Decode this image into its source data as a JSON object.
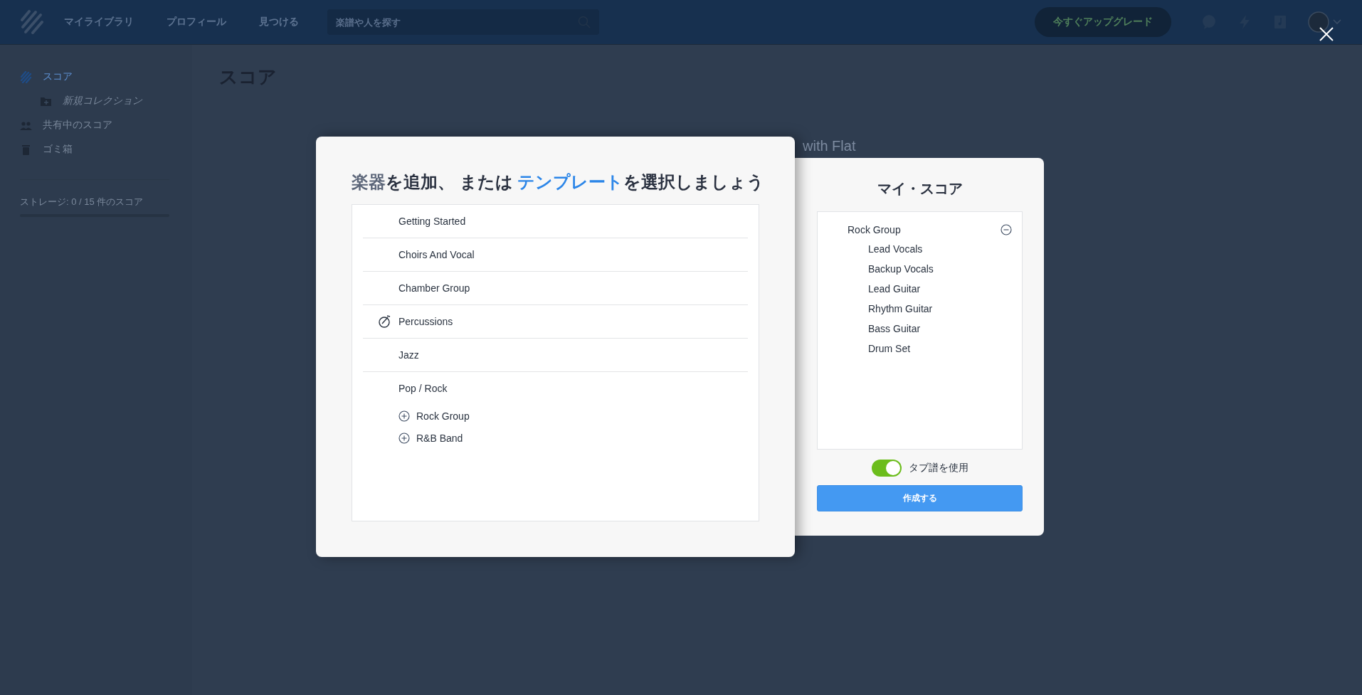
{
  "topbar": {
    "nav": [
      {
        "label": "マイライブラリ"
      },
      {
        "label": "プロフィール"
      },
      {
        "label": "見つける"
      }
    ],
    "search": {
      "placeholder": "楽譜や人を探す"
    },
    "upgrade_button": "今すぐアップグレード"
  },
  "sidebar": {
    "items": [
      {
        "label": "スコア",
        "kind": "scores",
        "selected": true,
        "children": [
          {
            "label": "新規コレクション",
            "kind": "new-collection",
            "selected": false
          }
        ]
      },
      {
        "label": "共有中のスコア",
        "kind": "shared",
        "selected": false
      },
      {
        "label": "ゴミ箱",
        "kind": "trash",
        "selected": false
      }
    ],
    "storage": {
      "label": "ストレージ: 0 / 15 件のスコア",
      "level": 0
    }
  },
  "page": {
    "title": "スコア",
    "background_text": "with Flat"
  },
  "template_dialog": {
    "title_parts": [
      {
        "text": "楽器",
        "kind": "link",
        "selected": false
      },
      {
        "text": "を追加、 または ",
        "kind": "text"
      },
      {
        "text": "テンプレート",
        "kind": "link",
        "selected": true
      },
      {
        "text": "を選択しましょう",
        "kind": "text"
      }
    ],
    "categories": [
      {
        "label": "Getting Started",
        "kind": "plain"
      },
      {
        "label": "Choirs And Vocal",
        "kind": "plain"
      },
      {
        "label": "Chamber Group",
        "kind": "plain"
      },
      {
        "label": "Percussions",
        "kind": "drum"
      },
      {
        "label": "Jazz",
        "kind": "plain"
      },
      {
        "label": "Pop / Rock",
        "kind": "plain",
        "children": [
          {
            "label": "Rock Group"
          },
          {
            "label": "R&B Band"
          }
        ]
      }
    ]
  },
  "score_panel": {
    "title": "マイ・スコア",
    "groups": [
      {
        "label": "Rock Group",
        "children": [
          {
            "label": "Lead Vocals"
          },
          {
            "label": "Backup Vocals"
          },
          {
            "label": "Lead Guitar"
          },
          {
            "label": "Rhythm Guitar"
          },
          {
            "label": "Bass Guitar"
          },
          {
            "label": "Drum Set"
          }
        ]
      }
    ],
    "tab_toggle": {
      "label": "タブ譜を使用",
      "on": true
    },
    "create_button": "作成する"
  }
}
